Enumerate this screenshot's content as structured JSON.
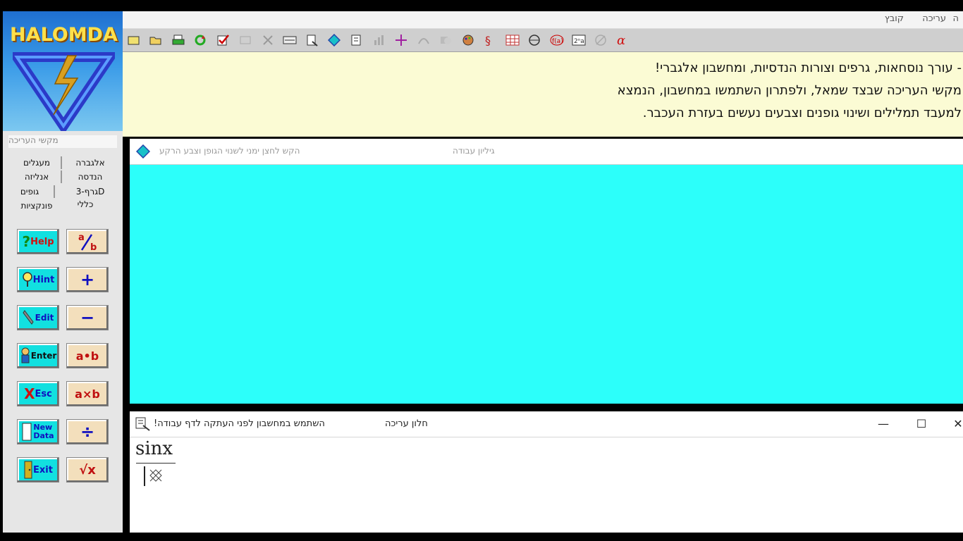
{
  "logo": {
    "text": "HALOMDA"
  },
  "menu": [
    {
      "id": "h",
      "label": "ה"
    },
    {
      "id": "edit",
      "label": "עריכה"
    },
    {
      "id": "file",
      "label": "קובץ"
    }
  ],
  "banner": {
    "line1": "- עורך נוסחאות, גרפים וצורות הנדסיות, ומחשבון אלגברי!",
    "line2": "מקשי העריכה שבצד שמאל, ולפתרון השתמשו במחשבון, הנמצא",
    "line3": "למעבד תמלילים ושינוי גופנים וצבעים נעשים בעזרת העכבר."
  },
  "left_panel": {
    "title": "מקשי העריכה",
    "categories": {
      "algebra": "אלגברה",
      "circles": "מעגלים",
      "geometry": "הנדסה",
      "analysis": "אנליזה",
      "graph3d": "גרף-3D",
      "bodies": "גופים",
      "general": "כללי",
      "functions": "פונקציות"
    },
    "buttons": {
      "help": "Help",
      "hint": "Hint",
      "edit": "Edit",
      "enter": "Enter",
      "esc": "Esc",
      "new_data_1": "New",
      "new_data_2": "Data",
      "exit": "Exit",
      "help_prefix": "?",
      "esc_prefix": "X",
      "fraction_a": "a",
      "fraction_b": "b",
      "plus": "+",
      "minus": "−",
      "dot": "a•b",
      "times": "a×b",
      "divide": "÷",
      "sqrt": "√x"
    }
  },
  "worksheet": {
    "title": "גיליון עבודה",
    "hint": "הקש לחצן ימני לשנוי הגופן וצבע הרקע"
  },
  "edit_window": {
    "title": "חלון עריכה",
    "hint": "השתמש במחשבון לפני העתקה לדף עבודה!",
    "numerator": "sinx",
    "minimize": "—",
    "maximize": "☐",
    "close": "✕"
  },
  "colors": {
    "worksheet_bg": "#2cfffa",
    "banner_bg": "#fbfbd4",
    "cyan_button": "#12e0e0",
    "tan_button": "#f3dfbc"
  }
}
